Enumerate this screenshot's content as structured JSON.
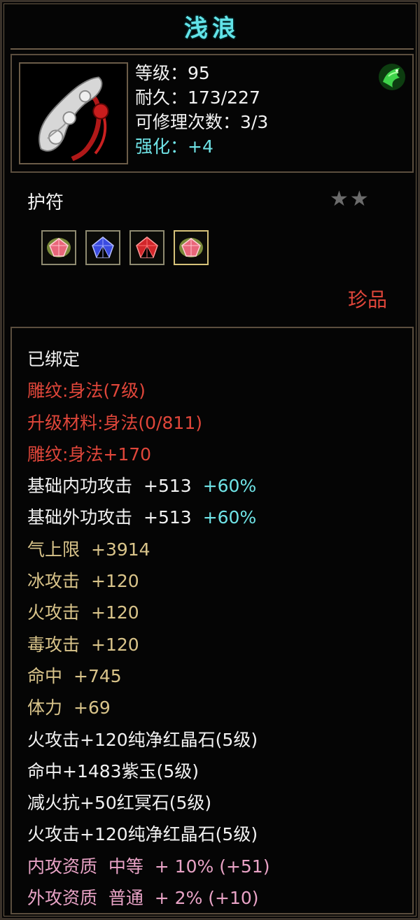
{
  "title": "浅浪",
  "item": {
    "stats": {
      "level": "等级：95",
      "durability": "耐久：173/227",
      "repairs": "可修理次数：3/3",
      "enhance": "强化：+4"
    },
    "type": "护符",
    "stars": "★★",
    "rarity": "珍品",
    "badge_icon": "green-dragon-emblem-icon",
    "gems": [
      {
        "icon": "pink-gem-icon",
        "color": "#e8667a",
        "selected": false
      },
      {
        "icon": "blue-gem-icon",
        "color": "#3a4be0",
        "selected": false
      },
      {
        "icon": "red-gem-icon",
        "color": "#d1262a",
        "selected": false
      },
      {
        "icon": "pink-gem-icon",
        "color": "#e8667a",
        "selected": true
      }
    ]
  },
  "attributes": {
    "bound": "已绑定",
    "engrave": "雕纹:身法(7级)",
    "upgrade_material": "升级材料:身法(0/811)",
    "engrave_bonus": "雕纹:身法+170",
    "base_internal_attack": {
      "label": "基础内功攻击",
      "value": "+513",
      "pct": "+60%"
    },
    "base_external_attack": {
      "label": "基础外功攻击",
      "value": "+513",
      "pct": "+60%"
    },
    "qi_limit": {
      "label": "气上限",
      "value": "+3914"
    },
    "ice_attack": {
      "label": "冰攻击",
      "value": "+120"
    },
    "fire_attack": {
      "label": "火攻击",
      "value": "+120"
    },
    "poison_attack": {
      "label": "毒攻击",
      "value": "+120"
    },
    "accuracy": {
      "label": "命中",
      "value": "+745"
    },
    "stamina": {
      "label": "体力",
      "value": "+69"
    },
    "gem_line_1": "火攻击+120纯净红晶石(5级)",
    "gem_line_2": "命中+1483紫玉(5级)",
    "gem_line_3": "减火抗+50红冥石(5级)",
    "gem_line_4": "火攻击+120纯净红晶石(5级)",
    "internal_aptitude": "内攻资质  中等  + 10% (+51)",
    "external_aptitude": "外攻资质  普通  + 2% (+10)"
  },
  "colors": {
    "title": "#62e3e8",
    "red": "#e0463a",
    "gold": "#d9c48a",
    "pink": "#e9a3c6",
    "cyan": "#6fe3e6"
  }
}
